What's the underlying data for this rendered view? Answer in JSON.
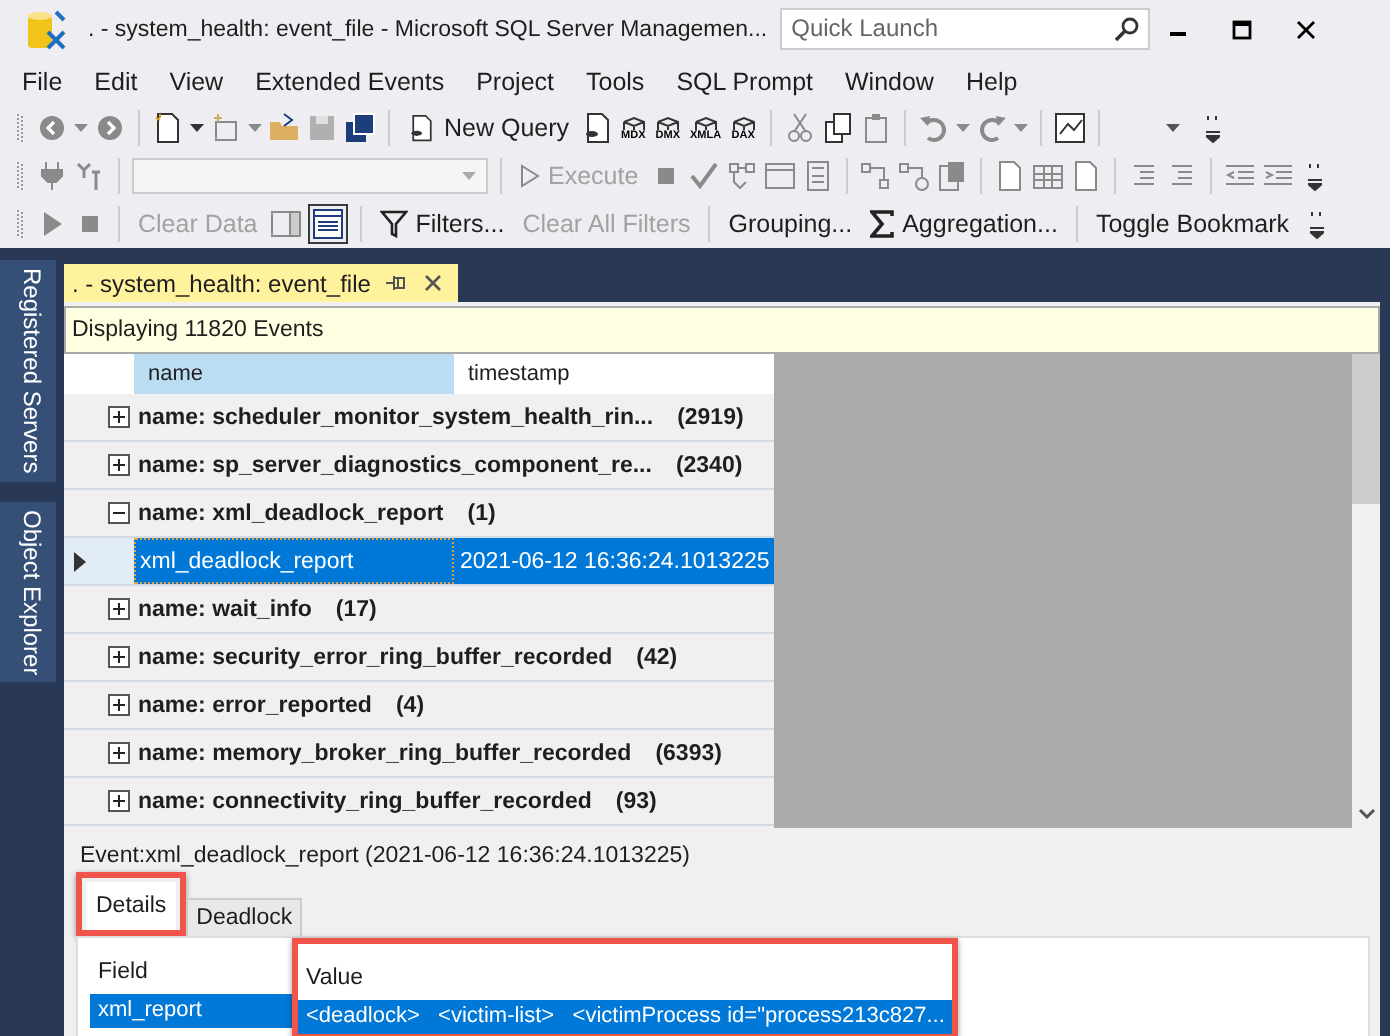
{
  "window": {
    "title": ". - system_health: event_file - Microsoft SQL Server Managemen..."
  },
  "quick_launch": {
    "placeholder": "Quick Launch"
  },
  "menu": [
    "File",
    "Edit",
    "View",
    "Extended Events",
    "Project",
    "Tools",
    "SQL Prompt",
    "Window",
    "Help"
  ],
  "toolbar_1": {
    "new_query": "New Query",
    "query_types": [
      "MDX",
      "DMX",
      "XMLA",
      "DAX"
    ]
  },
  "toolbar_2": {
    "execute": {
      "label": "Execute",
      "disabled": true
    }
  },
  "toolbar_3": [
    {
      "label": "Clear Data",
      "disabled": true
    },
    {
      "label": "Filters...",
      "disabled": false
    },
    {
      "label": "Clear All Filters",
      "disabled": true
    },
    {
      "label": "Grouping...",
      "disabled": false
    },
    {
      "label": "Aggregation...",
      "disabled": false
    },
    {
      "label": "Toggle Bookmark",
      "disabled": false
    }
  ],
  "side_tabs": [
    "Registered Servers",
    "Object Explorer"
  ],
  "document_tab": {
    "title": ". - system_health: event_file"
  },
  "info_bar": "Displaying 11820 Events",
  "grid": {
    "columns": [
      {
        "label": "name",
        "selected": true
      },
      {
        "label": "timestamp",
        "selected": false
      }
    ],
    "groups": [
      {
        "label": "name: scheduler_monitor_system_health_rin...",
        "count": "(2919)",
        "expanded": false
      },
      {
        "label": "name: sp_server_diagnostics_component_re...",
        "count": "(2340)",
        "expanded": false
      },
      {
        "label": "name: xml_deadlock_report",
        "count": "(1)",
        "expanded": true,
        "children": [
          {
            "name": "xml_deadlock_report",
            "timestamp": "2021-06-12 16:36:24.1013225",
            "selected": true
          }
        ]
      },
      {
        "label": "name: wait_info",
        "count": "(17)",
        "expanded": false
      },
      {
        "label": "name: security_error_ring_buffer_recorded",
        "count": "(42)",
        "expanded": false
      },
      {
        "label": "name: error_reported",
        "count": "(4)",
        "expanded": false
      },
      {
        "label": "name: memory_broker_ring_buffer_recorded",
        "count": "(6393)",
        "expanded": false
      },
      {
        "label": "name: connectivity_ring_buffer_recorded",
        "count": "(93)",
        "expanded": false
      }
    ]
  },
  "event_title": "Event:xml_deadlock_report (2021-06-12 16:36:24.1013225)",
  "detail_tabs": [
    {
      "label": "Details",
      "selected": true,
      "highlighted": true
    },
    {
      "label": "Deadlock",
      "selected": false,
      "highlighted": false
    }
  ],
  "details_grid": {
    "columns": [
      {
        "label": "Field",
        "highlighted": false
      },
      {
        "label": "Value",
        "highlighted": true
      }
    ],
    "rows": [
      {
        "field": "xml_report",
        "value": "<deadlock>   <victim-list>   <victimProcess id=\"process213c827...",
        "selected": true
      }
    ]
  }
}
